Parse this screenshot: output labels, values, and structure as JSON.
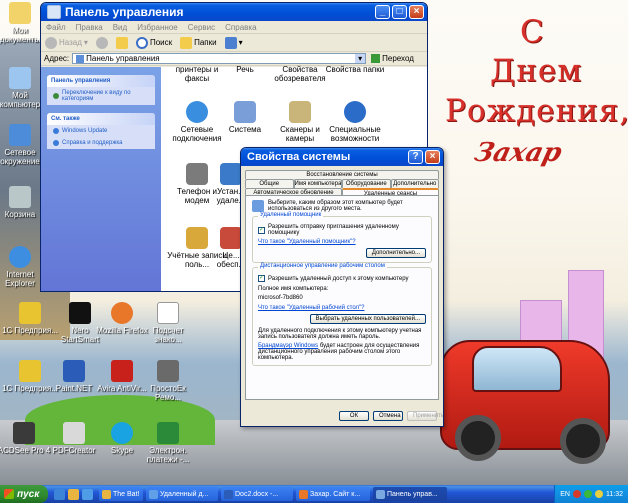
{
  "wallpaper": {
    "greeting_lines": [
      "С",
      "Днем",
      "Рождения,"
    ],
    "signature": "Захар"
  },
  "desktop_icons": [
    {
      "label": "Мои документы",
      "icon": "my-documents-icon"
    },
    {
      "label": "Мой компьютер",
      "icon": "my-computer-icon"
    },
    {
      "label": "Сетевое окружение",
      "icon": "network-places-icon"
    },
    {
      "label": "Корзина",
      "icon": "recycle-bin-icon"
    },
    {
      "label": "Internet Explorer",
      "icon": "internet-explorer-icon"
    },
    {
      "label": "1С Предприя...",
      "icon": "1c-icon"
    },
    {
      "label": "Nero StartSmart",
      "icon": "nero-icon"
    },
    {
      "label": "Mozilla Firefox",
      "icon": "firefox-icon"
    },
    {
      "label": "Подсчет знако...",
      "icon": "document-icon"
    },
    {
      "label": "1С Предприя...",
      "icon": "1c-icon"
    },
    {
      "label": "Paint.NET",
      "icon": "paint-net-icon"
    },
    {
      "label": "Avira AntiVir...",
      "icon": "avira-icon"
    },
    {
      "label": "ПростоЕк Ремо...",
      "icon": "program-icon"
    },
    {
      "label": "ACDSee Pro 4",
      "icon": "acdsee-icon"
    },
    {
      "label": "PDFCreator",
      "icon": "pdfcreator-icon"
    },
    {
      "label": "Skype",
      "icon": "skype-icon"
    },
    {
      "label": "Электрон. платежи -...",
      "icon": "payments-icon"
    }
  ],
  "control_panel": {
    "title": "Панель управления",
    "menu": [
      "Файл",
      "Правка",
      "Вид",
      "Избранное",
      "Сервис",
      "Справка"
    ],
    "toolbar": {
      "back": "Назад",
      "search": "Поиск",
      "folders": "Папки"
    },
    "address": {
      "label": "Адрес:",
      "value": "Панель управления",
      "go": "Переход"
    },
    "taskpane": {
      "panel1": {
        "title": "Панель управления",
        "items": [
          "Переключение к виду по категориям"
        ]
      },
      "panel2": {
        "title": "См. также",
        "items": [
          "Windows Update",
          "Справка и поддержка"
        ]
      }
    },
    "icons": [
      {
        "label": "принтеры и факсы",
        "icon": "printers-icon"
      },
      {
        "label": "Речь",
        "icon": "speech-icon"
      },
      {
        "label": "Свойства обозревателя",
        "icon": "internet-options-icon"
      },
      {
        "label": "Свойства папки",
        "icon": "folder-options-icon"
      },
      {
        "label": "Сетевые подключения",
        "icon": "network-connections-icon"
      },
      {
        "label": "Система",
        "icon": "system-icon"
      },
      {
        "label": "Сканеры и камеры",
        "icon": "scanners-icon"
      },
      {
        "label": "Специальные возможности",
        "icon": "accessibility-icon"
      },
      {
        "label": "Телефон и модем",
        "icon": "phone-modem-icon"
      },
      {
        "label": "Устан... удале...",
        "icon": "add-remove-icon"
      },
      {
        "label": "Учётные записи поль...",
        "icon": "user-accounts-icon"
      },
      {
        "label": "Це... обесп...",
        "icon": "security-center-icon"
      }
    ]
  },
  "system_properties": {
    "title": "Свойства системы",
    "tabs_top": [
      "Восстановление системы"
    ],
    "tabs_mid": [
      "Общие",
      "Имя компьютера",
      "Оборудование",
      "Дополнительно"
    ],
    "tabs_bot": [
      "Автоматическое обновление",
      "Удаленные сеансы"
    ],
    "intro": "Выберите, каким образом этот компьютер будет использоваться из другого места.",
    "assistance": {
      "title": "Удаленный помощник",
      "checkbox": "Разрешить отправку приглашения удаленному помощнику",
      "checked": true,
      "link": "Что такое \"Удаленный помощник\"?",
      "button": "Дополнительно..."
    },
    "desktop": {
      "title": "Дистанционное управление рабочим столом",
      "checkbox": "Разрешить удаленный доступ к этому компьютеру",
      "checked": true,
      "fullname_label": "Полное имя компьютера:",
      "fullname": "microsof-7bd860",
      "link": "Что такое \"Удаленный рабочий стол\"?",
      "button": "Выбрать удаленных пользователей..."
    },
    "note1": "Для удаленного подключения к этому компьютеру учетная запись пользователя должна иметь пароль.",
    "note2_link": "Брандмауэр Windows",
    "note2": "будет настроен для осуществления дистанционного управления рабочим столом этого компьютера.",
    "buttons": {
      "ok": "ОК",
      "cancel": "Отмена",
      "apply": "Применить"
    }
  },
  "taskbar": {
    "start": "пуск",
    "tasks": [
      {
        "label": "The Bat!",
        "icon": "bat-icon"
      },
      {
        "label": "Удаленный д...",
        "icon": "remote-icon"
      },
      {
        "label": "Doc2.docx -...",
        "icon": "word-icon"
      },
      {
        "label": "Захар. Сайт к...",
        "icon": "browser-icon"
      },
      {
        "label": "Панель управ...",
        "icon": "control-panel-icon"
      }
    ],
    "lang": "EN",
    "clock": "11:32"
  },
  "colors": {
    "xp_blue": "#0050d8",
    "title_text": "#ffffff",
    "greeting_red": "#d8302a"
  }
}
